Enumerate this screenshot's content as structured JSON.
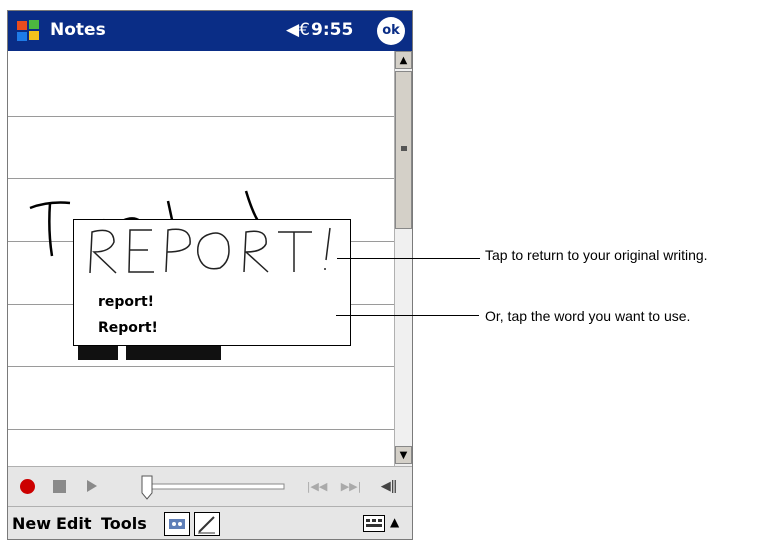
{
  "titlebar": {
    "app_title": "Notes",
    "time": "9:55",
    "ok_label": "ok",
    "speaker_glyph": "◀€"
  },
  "popup": {
    "items": [
      "report!",
      "Report!"
    ]
  },
  "commandbar": {
    "menus": [
      "New",
      "Edit",
      "Tools"
    ]
  },
  "callouts": {
    "first": "Tap to return to your original writing.",
    "second": "Or, tap the word you want  to use."
  },
  "colors": {
    "titlebar": "#0a2d86",
    "record": "#cc0000",
    "toolbar": "#e6e6e6"
  }
}
